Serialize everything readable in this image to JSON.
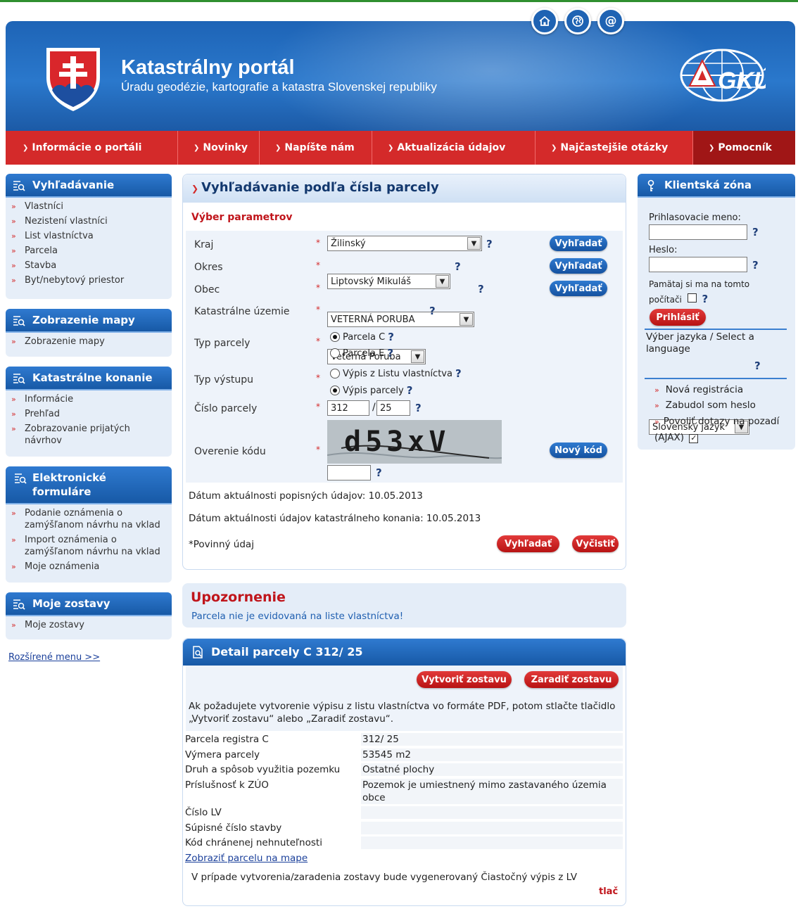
{
  "header": {
    "title": "Katastrálny portál",
    "subtitle": "Úradu geodézie, kartografie a katastra Slovenskej republiky",
    "logo_text": "GKÚ",
    "buttons": [
      "home-icon",
      "globe-icon",
      "at-icon"
    ]
  },
  "nav": [
    "Informácie o portáli",
    "Novinky",
    "Napíšte nám",
    "Aktualizácia údajov",
    "Najčastejšie otázky",
    "Pomocník"
  ],
  "sidebar": {
    "search": {
      "title": "Vyhľadávanie",
      "items": [
        "Vlastníci",
        "Nezistení vlastníci",
        "List vlastníctva",
        "Parcela",
        "Stavba",
        "Byt/nebytový priestor"
      ]
    },
    "maps": {
      "title": "Zobrazenie mapy",
      "items": [
        "Zobrazenie mapy"
      ]
    },
    "proceedings": {
      "title": "Katastrálne konanie",
      "items": [
        "Informácie",
        "Prehľad",
        "Zobrazovanie prijatých návrhov"
      ]
    },
    "forms": {
      "title": "Elektronické formuláre",
      "items": [
        "Podanie oznámenia o zamýšľanom návrhu na vklad",
        "Import oznámenia o zamýšľanom návrhu na vklad",
        "Moje oznámenia"
      ]
    },
    "reports": {
      "title": "Moje zostavy",
      "items": [
        "Moje zostavy"
      ]
    },
    "extended_menu": "Rozšírené menu >>"
  },
  "search_panel": {
    "title": "Vyhľadávanie podľa čísla parcely",
    "section": "Výber parametrov",
    "required_mark": "*",
    "help": "?",
    "fields": {
      "kraj": {
        "label": "Kraj",
        "value": "Žilinský",
        "button": "Vyhľadať"
      },
      "okres": {
        "label": "Okres",
        "value": "Liptovský Mikuláš",
        "button": "Vyhľadať"
      },
      "obec": {
        "label": "Obec",
        "value": "VETERNÁ PORUBA",
        "button": "Vyhľadať"
      },
      "ku": {
        "label": "Katastrálne územie",
        "value": "Veterná Poruba"
      },
      "typ_parcely": {
        "label": "Typ parcely",
        "options": [
          "Parcela C",
          "Parcela E"
        ],
        "selected": "Parcela C"
      },
      "typ_vystupu": {
        "label": "Typ výstupu",
        "options": [
          "Výpis z Listu vlastníctva",
          "Výpis parcely"
        ],
        "selected": "Výpis parcely"
      },
      "cislo_parcely": {
        "label": "Číslo parcely",
        "value1": "312",
        "separator": "/",
        "value2": "25"
      },
      "overenie": {
        "label": "Overenie kódu",
        "captcha": "d53xV",
        "value": "",
        "button": "Nový kód"
      }
    },
    "date_desc": "Dátum aktuálnosti popisných údajov: 10.05.2013",
    "date_proc": "Dátum aktuálnosti údajov katastrálneho konania: 10.05.2013",
    "required_note": "*Povinný údaj",
    "search_button": "Vyhľadať",
    "clear_button": "Vyčistiť"
  },
  "warning": {
    "title": "Upozornenie",
    "text": "Parcela nie je evidovaná na liste vlastníctva!"
  },
  "detail": {
    "title": "Detail parcely C 312/ 25",
    "create_button": "Vytvoriť zostavu",
    "add_button": "Zaradiť zostavu",
    "info": "Ak požadujete vytvorenie výpisu z listu vlastníctva vo formáte PDF, potom stlačte tlačidlo „Vytvoriť zostavu“ alebo „Zaradiť zostavu“.",
    "rows": [
      {
        "key": "Parcela registra C",
        "value": "312/ 25"
      },
      {
        "key": "Výmera parcely",
        "value": "53545 m2"
      },
      {
        "key": "Druh a spôsob využitia pozemku",
        "value": "Ostatné plochy"
      },
      {
        "key": "Príslušnosť k ZÚO",
        "value": "Pozemok je umiestnený mimo zastavaného územia obce"
      },
      {
        "key": "Číslo LV",
        "value": ""
      },
      {
        "key": "Súpisné číslo stavby",
        "value": ""
      },
      {
        "key": "Kód chránenej nehnuteľnosti",
        "value": ""
      }
    ],
    "map_link": "Zobraziť parcelu na mape",
    "footnote": "V prípade vytvorenia/zaradenia zostavy bude vygenerovaný Čiastočný výpis z LV",
    "print": "tlač"
  },
  "client_zone": {
    "title": "Klientská zóna",
    "login_label": "Prihlasovacie meno:",
    "login_value": "",
    "password_label": "Heslo:",
    "password_value": "",
    "remember_label": "Pamätaj si ma na tomto počítači",
    "login_button": "Prihlásiť",
    "language_label": "Výber jazyka / Select a language",
    "language_value": "Slovenský jazyk",
    "links": [
      "Nová registrácia",
      "Zabudol som heslo",
      "Povoliť dotazy na pozadí (AJAX)"
    ],
    "ajax_checked": true
  },
  "colors": {
    "brand_blue": "#1e64b6",
    "nav_red": "#d42a2a",
    "nav_dark_red": "#a01616",
    "warning_red": "#c0151b"
  }
}
